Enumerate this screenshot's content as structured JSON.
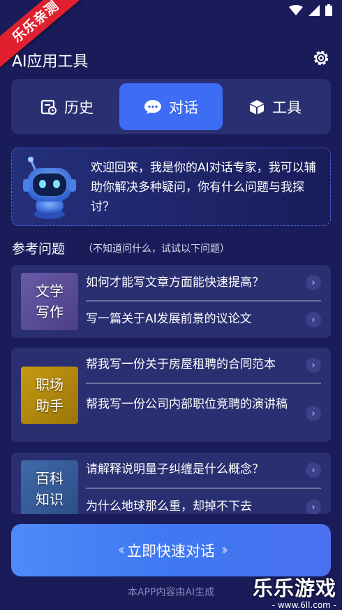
{
  "ribbon": {
    "label": "乐乐亲测"
  },
  "header": {
    "title": "AI应用工具",
    "settings_icon": "gear-icon"
  },
  "tabs": [
    {
      "label": "历史",
      "icon": "history-icon",
      "active": false
    },
    {
      "label": "对话",
      "icon": "chat-bubble-icon",
      "active": true
    },
    {
      "label": "工具",
      "icon": "cube-icon",
      "active": false
    }
  ],
  "welcome": {
    "icon": "robot-icon",
    "text": "欢迎回来，我是你的AI对话专家，我可以辅助你解决多种疑问，你有什么问题与我探讨？"
  },
  "suggestions": {
    "title": "参考问题",
    "hint": "（不知道问什么，试试以下问题）",
    "categories": [
      {
        "label_line1": "文学",
        "label_line2": "写作",
        "questions": [
          "如何才能写文章方面能快速提高？",
          "写一篇关于AI发展前景的议论文"
        ]
      },
      {
        "label_line1": "职场",
        "label_line2": "助手",
        "questions": [
          "帮我写一份关于房屋租聘的合同范本",
          "帮我写一份公司内部职位竞聘的演讲稿"
        ]
      },
      {
        "label_line1": "百科",
        "label_line2": "知识",
        "questions": [
          "请解释说明量子纠缠是什么概念？",
          "为什么地球那么重，却掉不下去"
        ]
      }
    ]
  },
  "cta": {
    "label": "立即快速对话"
  },
  "footer": {
    "note": "本APP内容由AI生成"
  },
  "watermark": {
    "brand": "乐乐游戏",
    "url": "- www.6ll.com -"
  },
  "colors": {
    "background": "#1a1c5a",
    "card": "#2a2f72",
    "accent": "#3d6cf5",
    "ribbon": "#e0202f"
  }
}
